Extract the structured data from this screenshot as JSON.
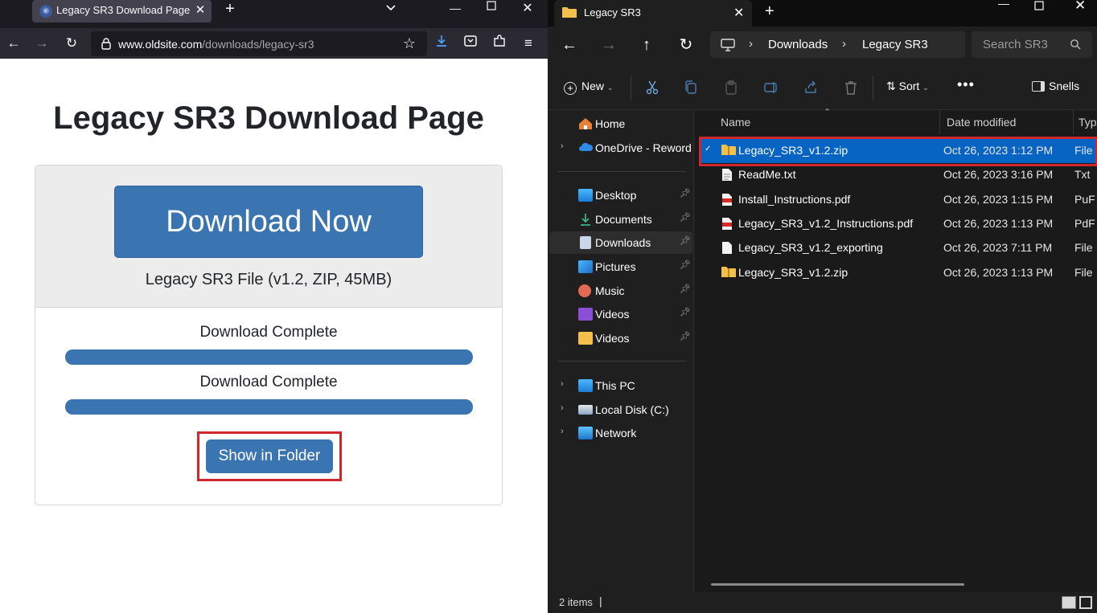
{
  "browser": {
    "tab_title": "Legacy SR3 Download Page",
    "url_host": "www.oldsite.com",
    "url_path": "/downloads/legacy-sr3",
    "page": {
      "title": "Legacy SR3 Download Page",
      "download_button": "Download Now",
      "file_info": "Legacy SR3 File (v1.2, ZIP, 45MB)",
      "status_1": "Download Complete",
      "status_2": "Download Complete",
      "progress_1": 1.0,
      "progress_2": 1.0,
      "show_folder_button": "Show in Folder"
    },
    "accent_color": "#3a74b1",
    "highlight_color": "#d0272c"
  },
  "explorer": {
    "window_title": "Legacy SR3",
    "breadcrumb": [
      "Downloads",
      "Legacy SR3"
    ],
    "search_placeholder": "Search SR3",
    "toolbar": {
      "new_label": "New",
      "sort_label": "Sort",
      "details_label": "Snells"
    },
    "nav": {
      "home": "Home",
      "onedrive": "OneDrive - Reword",
      "desktop": "Desktop",
      "documents": "Documents",
      "downloads": "Downloads",
      "pictures": "Pictures",
      "music": "Music",
      "videos_1": "Videos",
      "videos_2": "Videos",
      "this_pc": "This PC",
      "local_disk": "Local Disk (C:)",
      "network": "Network"
    },
    "columns": {
      "name": "Name",
      "date": "Date modified",
      "type": "Typ"
    },
    "files": [
      {
        "name": "Legacy_SR3_v1.2.zip",
        "date": "Oct 26, 2023 1:12 PM",
        "type": "File",
        "icon": "zip-folder-icon"
      },
      {
        "name": "ReadMe.txt",
        "date": "Oct 26, 2023 3:16 PM",
        "type": "Txt",
        "icon": "text-file-icon"
      },
      {
        "name": "Install_Instructions.pdf",
        "date": "Oct 26, 2023 1:15 PM",
        "type": "PuF",
        "icon": "pdf-file-icon"
      },
      {
        "name": "Legacy_SR3_v1.2_Instructions.pdf",
        "date": "Oct 26, 2023 1:13 PM",
        "type": "PdF",
        "icon": "pdf-file-icon"
      },
      {
        "name": "Legacy_SR3_v1.2_exporting",
        "date": "Oct 26, 2023 7:11 PM",
        "type": "File",
        "icon": "blank-file-icon"
      },
      {
        "name": "Legacy_SR3_v1.2.zip",
        "date": "Oct 26, 2023 1:13 PM",
        "type": "File",
        "icon": "zip-folder-icon"
      }
    ],
    "status": "2 items",
    "selection_color": "#0864c2"
  }
}
